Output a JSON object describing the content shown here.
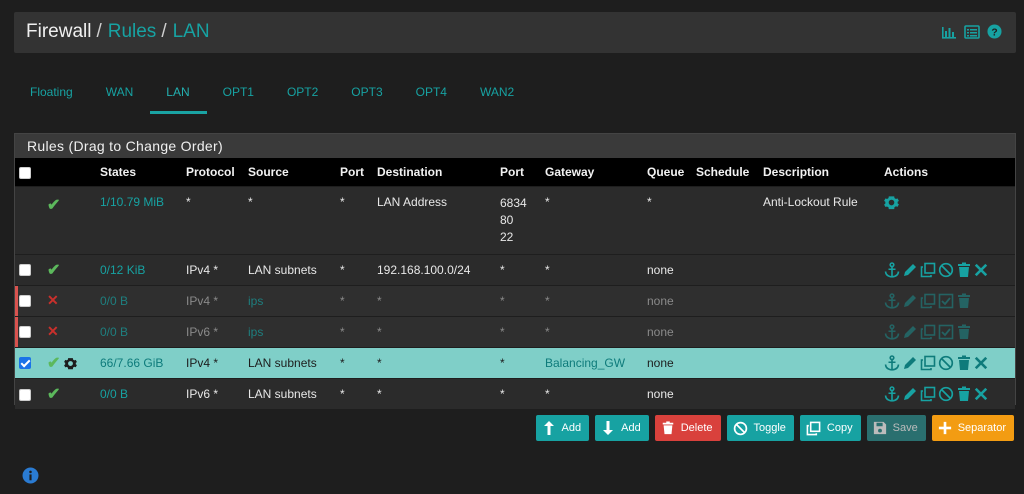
{
  "breadcrumb": {
    "root": "Firewall",
    "sep1": "/",
    "rules": "Rules",
    "sep2": "/",
    "current": "LAN"
  },
  "header_icons": [
    "chart-icon",
    "list-icon",
    "help-icon"
  ],
  "tabs": [
    {
      "label": "Floating",
      "active": false
    },
    {
      "label": "WAN",
      "active": false
    },
    {
      "label": "LAN",
      "active": true
    },
    {
      "label": "OPT1",
      "active": false
    },
    {
      "label": "OPT2",
      "active": false
    },
    {
      "label": "OPT3",
      "active": false
    },
    {
      "label": "OPT4",
      "active": false
    },
    {
      "label": "WAN2",
      "active": false
    }
  ],
  "panel": {
    "title": "Rules (Drag to Change Order)"
  },
  "columns": [
    "States",
    "Protocol",
    "Source",
    "Port",
    "Destination",
    "Port",
    "Gateway",
    "Queue",
    "Schedule",
    "Description",
    "Actions"
  ],
  "rows": [
    {
      "status": "pass",
      "selected": false,
      "disabled": false,
      "checkbox": false,
      "states": "1/10.79 MiB",
      "protocol": "*",
      "source": "*",
      "src_port": "*",
      "destination": "LAN Address",
      "dst_port": [
        "6834",
        "80",
        "22"
      ],
      "gateway": "*",
      "queue": "*",
      "schedule": "",
      "description": "Anti-Lockout Rule"
    },
    {
      "status": "pass",
      "selected": false,
      "disabled": false,
      "checkbox": true,
      "states": "0/12 KiB",
      "protocol": "IPv4 *",
      "source": "LAN subnets",
      "src_port": "*",
      "destination": "192.168.100.0/24",
      "dst_port": "*",
      "gateway": "*",
      "queue": "none",
      "schedule": "",
      "description": ""
    },
    {
      "status": "block",
      "selected": false,
      "disabled": true,
      "checkbox": true,
      "states": "0/0 B",
      "protocol": "IPv4 *",
      "source": "ips",
      "src_port": "*",
      "destination": "*",
      "dst_port": "*",
      "gateway": "*",
      "queue": "none",
      "schedule": "",
      "description": ""
    },
    {
      "status": "block",
      "selected": false,
      "disabled": true,
      "checkbox": true,
      "states": "0/0 B",
      "protocol": "IPv6 *",
      "source": "ips",
      "src_port": "*",
      "destination": "*",
      "dst_port": "*",
      "gateway": "*",
      "queue": "none",
      "schedule": "",
      "description": ""
    },
    {
      "status": "pass",
      "selected": true,
      "disabled": false,
      "checkbox": true,
      "states": "66/7.66 GiB",
      "protocol": "IPv4 *",
      "source": "LAN subnets",
      "src_port": "*",
      "destination": "*",
      "dst_port": "*",
      "gateway": "Balancing_GW",
      "queue": "none",
      "schedule": "",
      "description": ""
    },
    {
      "status": "pass",
      "selected": false,
      "disabled": false,
      "checkbox": true,
      "states": "0/0 B",
      "protocol": "IPv6 *",
      "source": "LAN subnets",
      "src_port": "*",
      "destination": "*",
      "dst_port": "*",
      "gateway": "*",
      "queue": "none",
      "schedule": "",
      "description": ""
    }
  ],
  "buttons": {
    "add_top": "Add",
    "add_bottom": "Add",
    "delete": "Delete",
    "toggle": "Toggle",
    "copy": "Copy",
    "save": "Save",
    "separator": "Separator"
  },
  "colors": {
    "accent": "#17a2a2",
    "pass": "#5cb85c",
    "block": "#c9302c",
    "selected_row": "#7fcfc8",
    "delete": "#d9413c",
    "separator": "#f39c12"
  }
}
